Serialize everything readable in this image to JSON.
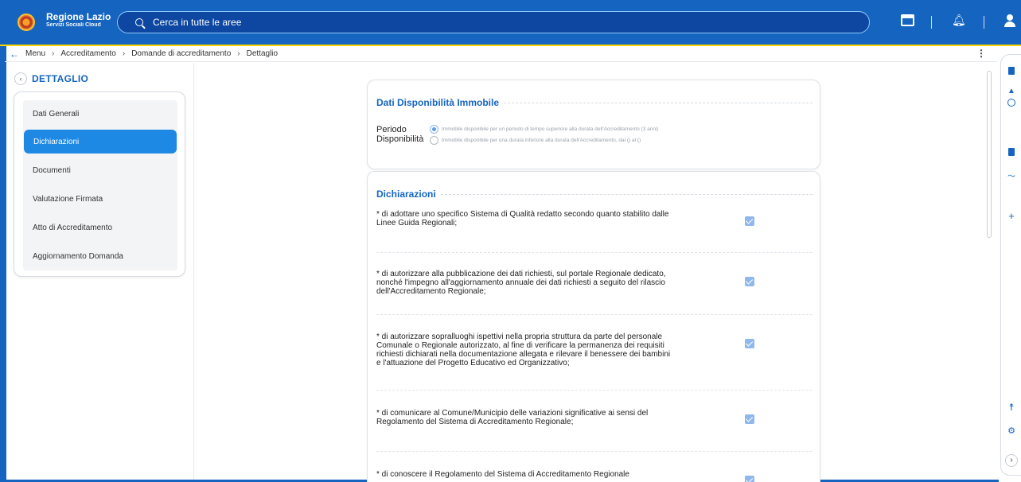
{
  "app": {
    "title": "Regione Lazio",
    "subtitle": "Servizi Sociali Cloud"
  },
  "search": {
    "placeholder": "Cerca in tutte le aree"
  },
  "breadcrumb": {
    "items": [
      "Menu",
      "Accreditamento",
      "Domande di accreditamento",
      "Dettaglio"
    ],
    "separator": "›",
    "back_icon": "arrow-left-icon"
  },
  "sidebar": {
    "title": "DETTAGLIO",
    "items": [
      {
        "label": "Dati Generali",
        "active": false
      },
      {
        "label": "Dichiarazioni",
        "active": true
      },
      {
        "label": "Documenti",
        "active": false
      },
      {
        "label": "Valutazione Firmata",
        "active": false
      },
      {
        "label": "Atto di Accreditamento",
        "active": false
      },
      {
        "label": "Aggiornamento Domanda",
        "active": false
      }
    ]
  },
  "disponibilita": {
    "title": "Dati Disponibilità Immobile",
    "period_label": [
      "Periodo",
      "Disponibilità"
    ],
    "options": [
      {
        "label": "Immobile disponibile per un periodo di tempo superiore alla durata dell'Accreditamento (3 anni)",
        "selected": true
      },
      {
        "label": "Immobile disponibile per una durata inferiore alla durata dell'Accreditamento, dal () al ()",
        "selected": false
      }
    ]
  },
  "dichiarazioni": {
    "title": "Dichiarazioni",
    "items": [
      {
        "text": "* di adottare uno specifico Sistema di Qualità redatto secondo quanto stabilito dalle Linee Guida Regionali;",
        "checked": true
      },
      {
        "text": "* di autorizzare alla pubblicazione dei dati richiesti, sul portale Regionale dedicato, nonché l'impegno all'aggiornamento annuale dei dati richiesti a seguito del rilascio dell'Accreditamento Regionale;",
        "checked": true
      },
      {
        "text": "* di autorizzare sopralluoghi ispettivi nella propria struttura da parte del personale Comunale o Regionale autorizzato, al fine di verificare la permanenza dei requisiti richiesti dichiarati nella documentazione allegata e rilevare il benessere dei bambini e l'attuazione del Progetto Educativo ed Organizzativo;",
        "checked": true
      },
      {
        "text": "* di comunicare al Comune/Municipio delle variazioni significative ai sensi del Regolamento del Sistema di Accreditamento Regionale;",
        "checked": true
      },
      {
        "text": "* di conoscere il Regolamento del Sistema di Accreditamento Regionale",
        "checked": true
      }
    ]
  },
  "colors": {
    "primary": "#1565c0",
    "accent_line": "#ffd600",
    "active_item": "#1e88e5",
    "checkbox": "#90b8ec"
  },
  "icons": {
    "topbar": [
      "window-icon",
      "bell-icon",
      "user-icon"
    ],
    "rail": [
      "calculator-icon",
      "car-icon",
      "history-icon",
      "bookmark-icon",
      "trend-icon",
      "plus-icon",
      "accessibility-icon",
      "gear-icon",
      "chevron-right-icon"
    ],
    "menu": "kebab-icon"
  }
}
